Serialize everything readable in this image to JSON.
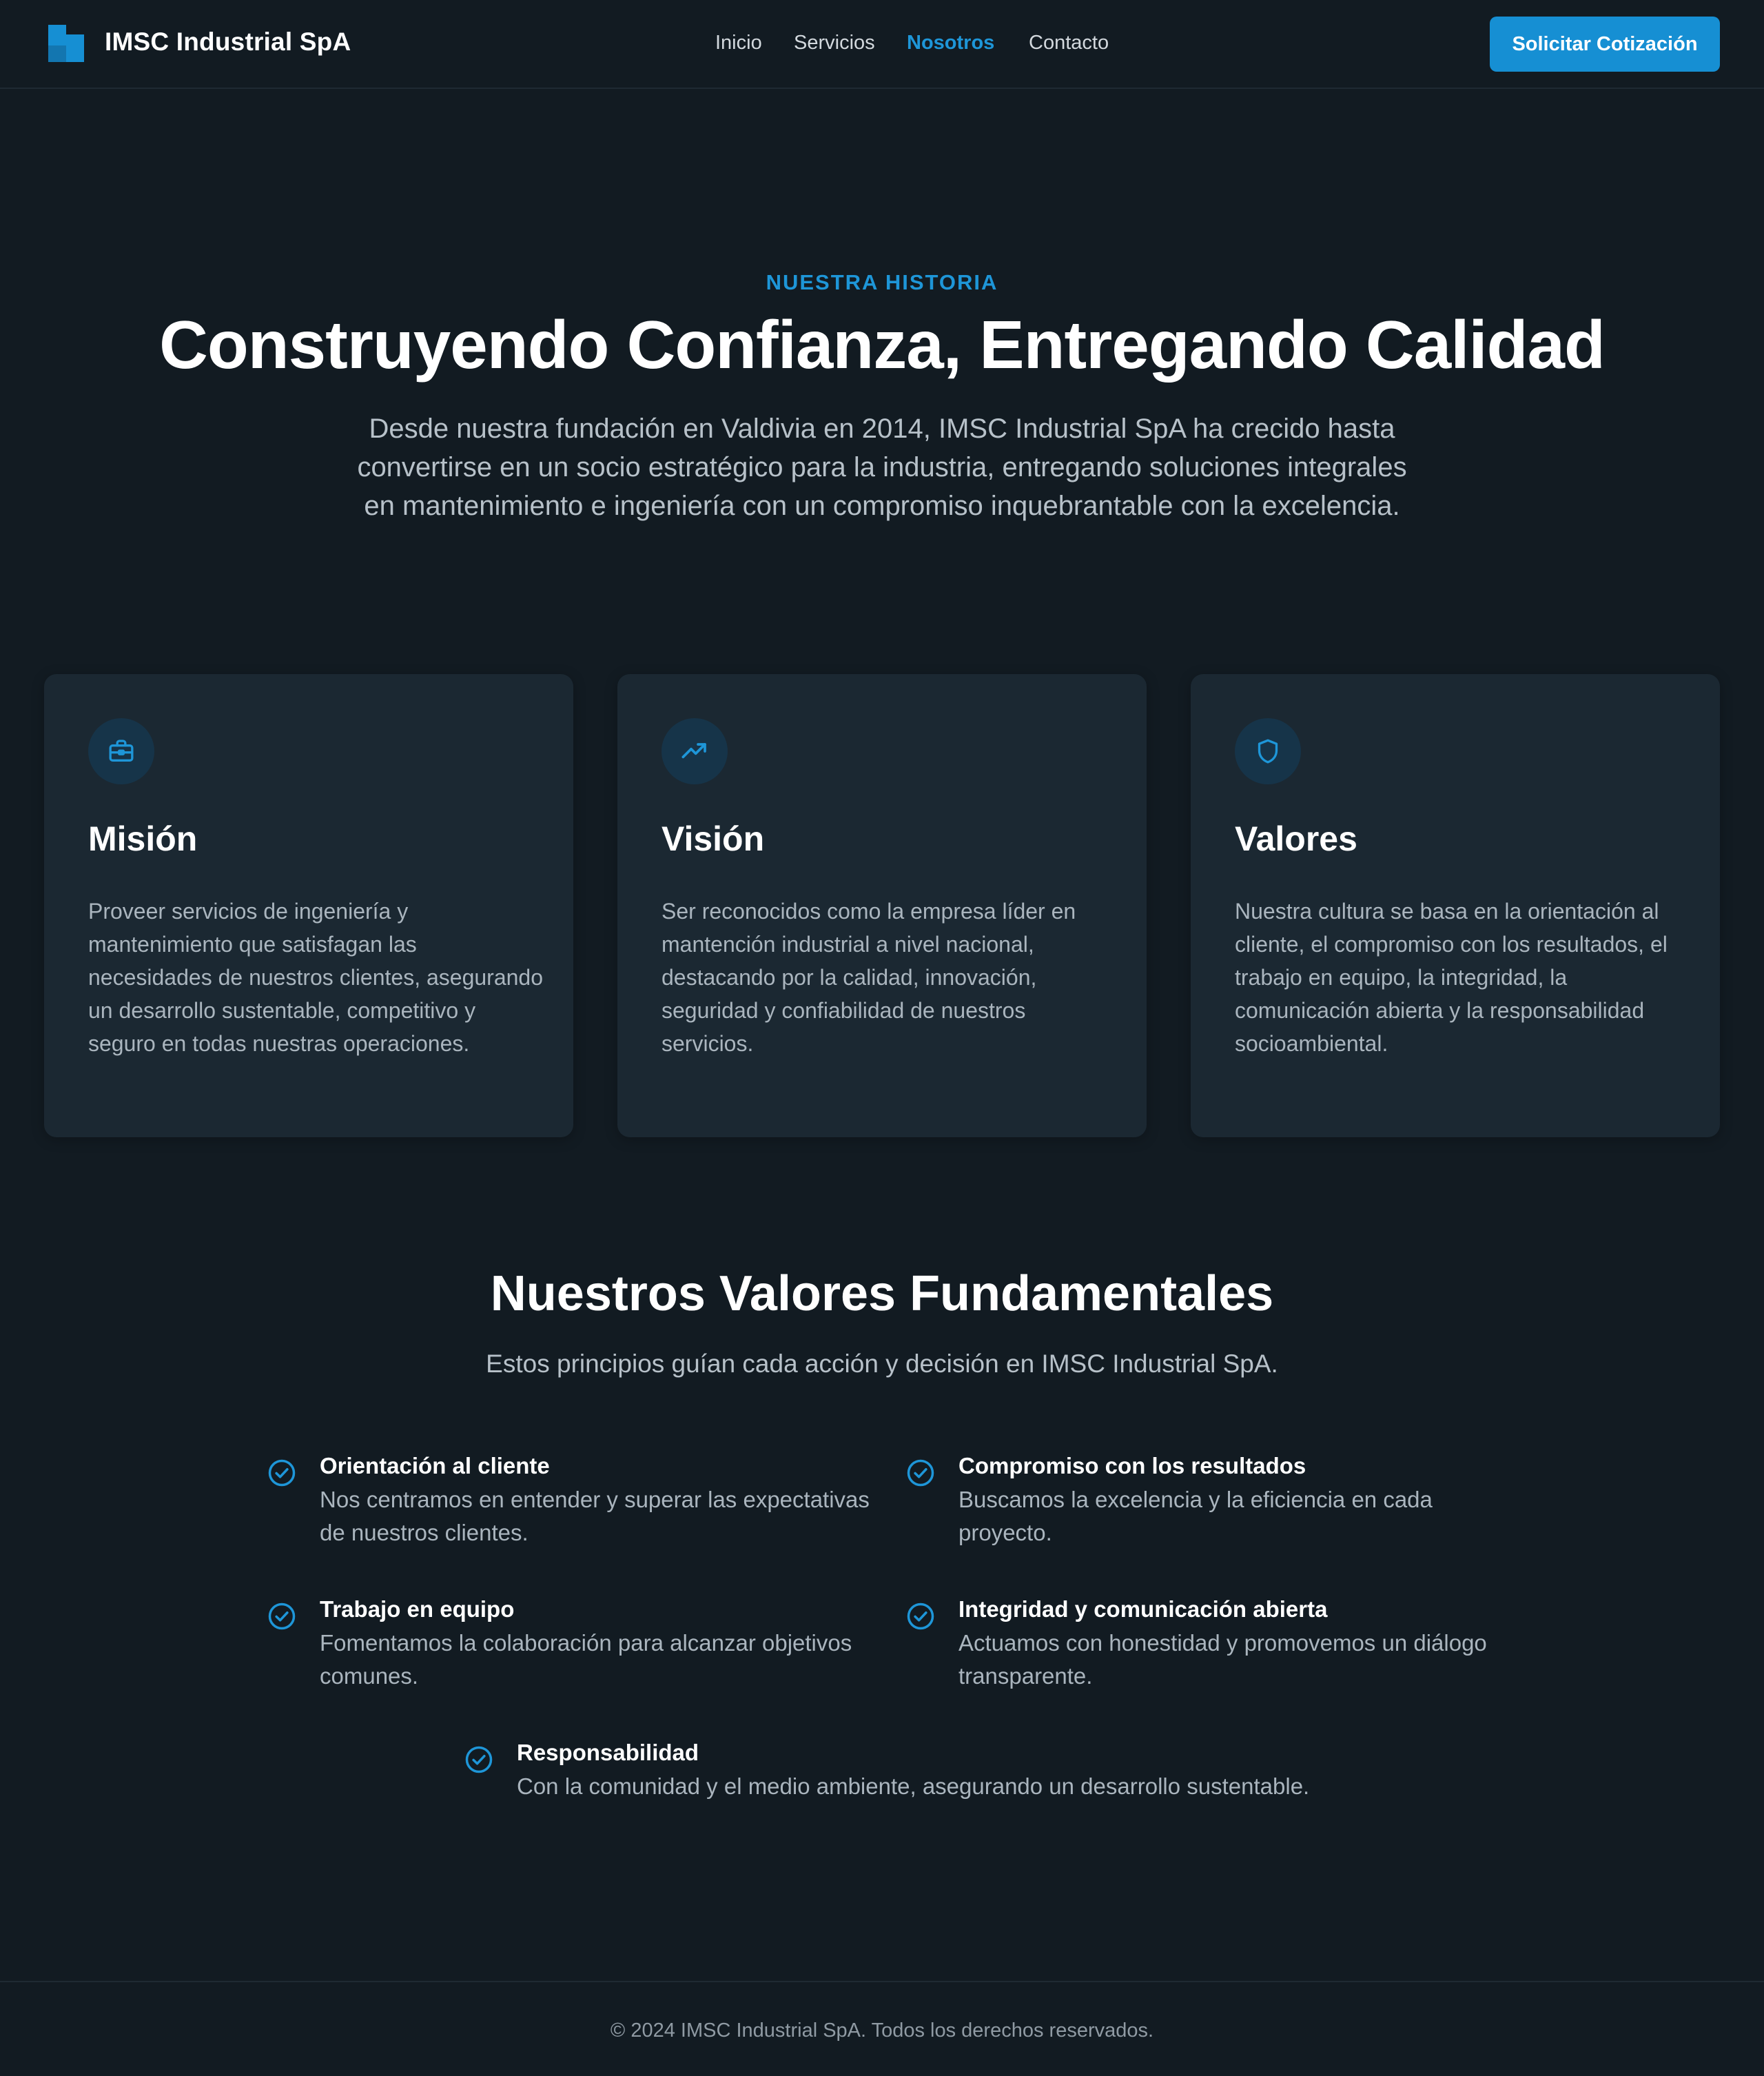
{
  "header": {
    "brand": "IMSC Industrial SpA",
    "logo_icon": "blocks-logo-icon",
    "nav": [
      {
        "label": "Inicio",
        "active": false
      },
      {
        "label": "Servicios",
        "active": false
      },
      {
        "label": "Nosotros",
        "active": true
      },
      {
        "label": "Contacto",
        "active": false
      }
    ],
    "cta_label": "Solicitar Cotización"
  },
  "hero": {
    "eyebrow": "NUESTRA HISTORIA",
    "title": "Construyendo Confianza, Entregando Calidad",
    "description": "Desde nuestra fundación en Valdivia en 2014, IMSC Industrial SpA ha crecido hasta convertirse en un socio estratégico para la industria, entregando soluciones integrales en mantenimiento e ingeniería con un compromiso inquebrantable con la excelencia."
  },
  "cards": [
    {
      "icon": "briefcase-icon",
      "title": "Misión",
      "text": "Proveer servicios de ingeniería y mantenimiento que satisfagan las necesidades de nuestros clientes, asegurando un desarrollo sustentable, competitivo y seguro en todas nuestras operaciones."
    },
    {
      "icon": "trending-up-icon",
      "title": "Visión",
      "text": "Ser reconocidos como la empresa líder en mantención industrial a nivel nacional, destacando por la calidad, innovación, seguridad y confiabilidad de nuestros servicios."
    },
    {
      "icon": "shield-icon",
      "title": "Valores",
      "text": "Nuestra cultura se basa en la orientación al cliente, el compromiso con los resultados, el trabajo en equipo, la integridad, la comunicación abierta y la responsabilidad socioambiental."
    }
  ],
  "values_section": {
    "title": "Nuestros Valores Fundamentales",
    "subtitle": "Estos principios guían cada acción y decisión en IMSC Industrial SpA.",
    "items": [
      {
        "title": "Orientación al cliente",
        "text": "Nos centramos en entender y superar las expectativas de nuestros clientes."
      },
      {
        "title": "Compromiso con los resultados",
        "text": "Buscamos la excelencia y la eficiencia en cada proyecto."
      },
      {
        "title": "Trabajo en equipo",
        "text": "Fomentamos la colaboración para alcanzar objetivos comunes."
      },
      {
        "title": "Integridad y comunicación abierta",
        "text": "Actuamos con honestidad y promovemos un diálogo transparente."
      },
      {
        "title": "Responsabilidad",
        "text": "Con la comunidad y el medio ambiente, asegurando un desarrollo sustentable."
      }
    ],
    "item_icon": "check-circle-icon"
  },
  "footer": {
    "text": "© 2024 IMSC Industrial SpA. Todos los derechos reservados."
  },
  "colors": {
    "background": "#121b22",
    "card": "#1b2832",
    "accent": "#168fd3",
    "accent_text": "#1e96d8",
    "muted_text": "#aab5be"
  }
}
